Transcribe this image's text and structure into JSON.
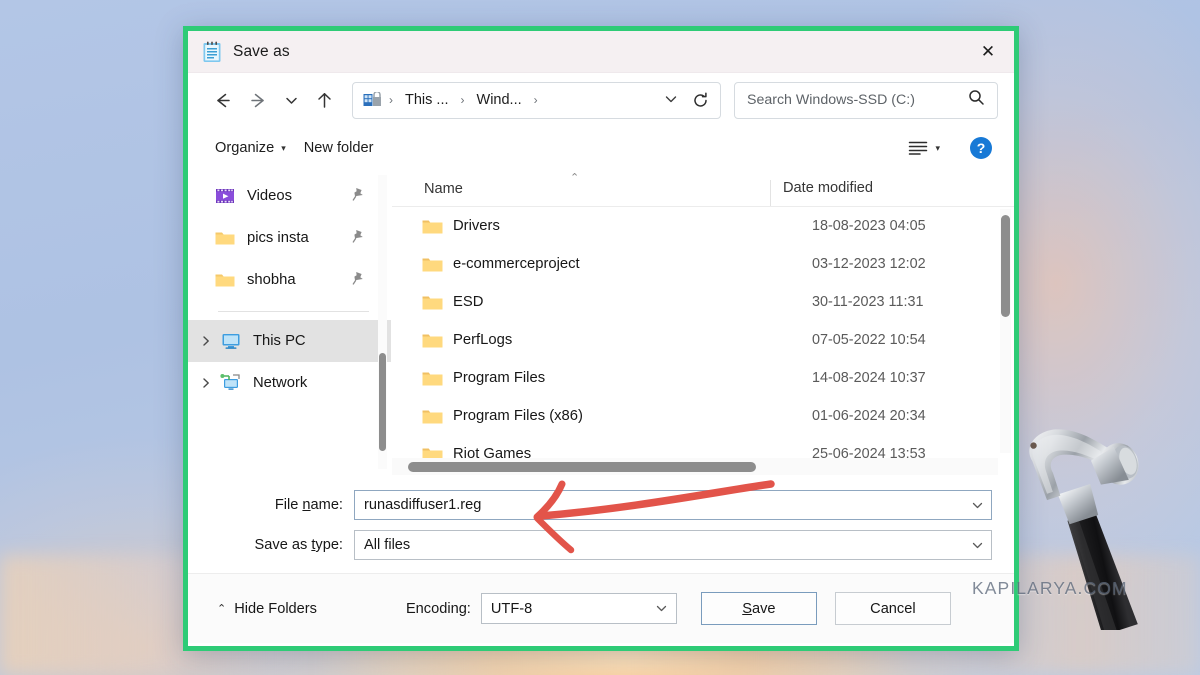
{
  "window": {
    "title": "Save as",
    "icon": "notepad-icon",
    "close_label": "✕",
    "border_color": "#2ecb76"
  },
  "navbar": {
    "back_icon": "arrow-left-icon",
    "forward_icon": "arrow-right-icon",
    "recent_icon": "chevron-down-icon",
    "up_icon": "arrow-up-icon",
    "breadcrumb": {
      "drive_icon": "drive-icon",
      "items": [
        "This ...",
        "Wind..."
      ],
      "separator": "›",
      "dropdown_icon": "chevron-down-icon",
      "refresh_icon": "refresh-icon"
    },
    "search": {
      "placeholder": "Search Windows-SSD (C:)",
      "value": "",
      "icon": "search-icon"
    }
  },
  "toolbar": {
    "organize_label": "Organize",
    "organize_caret": "▾",
    "new_folder_label": "New folder",
    "view_icon": "list-view-icon",
    "view_caret": "▾",
    "help_label": "?"
  },
  "sidebar": {
    "items": [
      {
        "label": "Videos",
        "icon": "videos-icon",
        "pinned": true,
        "selected": false,
        "expander": false
      },
      {
        "label": "pics insta",
        "icon": "folder-icon",
        "pinned": true,
        "selected": false,
        "expander": false
      },
      {
        "label": "shobha",
        "icon": "folder-icon",
        "pinned": true,
        "selected": false,
        "expander": false
      },
      {
        "label": "This PC",
        "icon": "this-pc-icon",
        "pinned": false,
        "selected": true,
        "expander": true
      },
      {
        "label": "Network",
        "icon": "network-icon",
        "pinned": false,
        "selected": false,
        "expander": true
      }
    ],
    "pin_icon": "pin-icon",
    "expander_icon": "chevron-right-icon"
  },
  "filelist": {
    "columns": [
      "Name",
      "Date modified"
    ],
    "sort_indicator": "⌃",
    "rows": [
      {
        "name": "Drivers",
        "date": "18-08-2023 04:05",
        "icon": "folder-icon"
      },
      {
        "name": "e-commerceproject",
        "date": "03-12-2023 12:02",
        "icon": "folder-icon"
      },
      {
        "name": "ESD",
        "date": "30-11-2023 11:31",
        "icon": "folder-icon"
      },
      {
        "name": "PerfLogs",
        "date": "07-05-2022 10:54",
        "icon": "folder-icon"
      },
      {
        "name": "Program Files",
        "date": "14-08-2024 10:37",
        "icon": "folder-icon"
      },
      {
        "name": "Program Files (x86)",
        "date": "01-06-2024 20:34",
        "icon": "folder-icon"
      },
      {
        "name": "Riot Games",
        "date": "25-06-2024 13:53",
        "icon": "folder-icon"
      }
    ]
  },
  "form": {
    "file_name_label_pre": "File ",
    "file_name_label_key": "n",
    "file_name_label_post": "ame:",
    "file_name_value": "runasdiffuser1.reg",
    "save_as_type_label_pre": "Save as ",
    "save_as_type_label_key": "t",
    "save_as_type_label_post": "ype:",
    "save_as_type_value": "All files",
    "dropdown_icon": "chevron-down-icon"
  },
  "footer": {
    "hide_folders_label": "Hide Folders",
    "hide_folders_caret": "⌃",
    "encoding_label": "Encoding:",
    "encoding_value": "UTF-8",
    "save_key": "S",
    "save_rest": "ave",
    "cancel_label": "Cancel"
  },
  "annotation": {
    "arrow_color": "#e2544a",
    "arrow_target": "file-name-field"
  },
  "watermark": {
    "text": "KAPILARYA.COM"
  }
}
